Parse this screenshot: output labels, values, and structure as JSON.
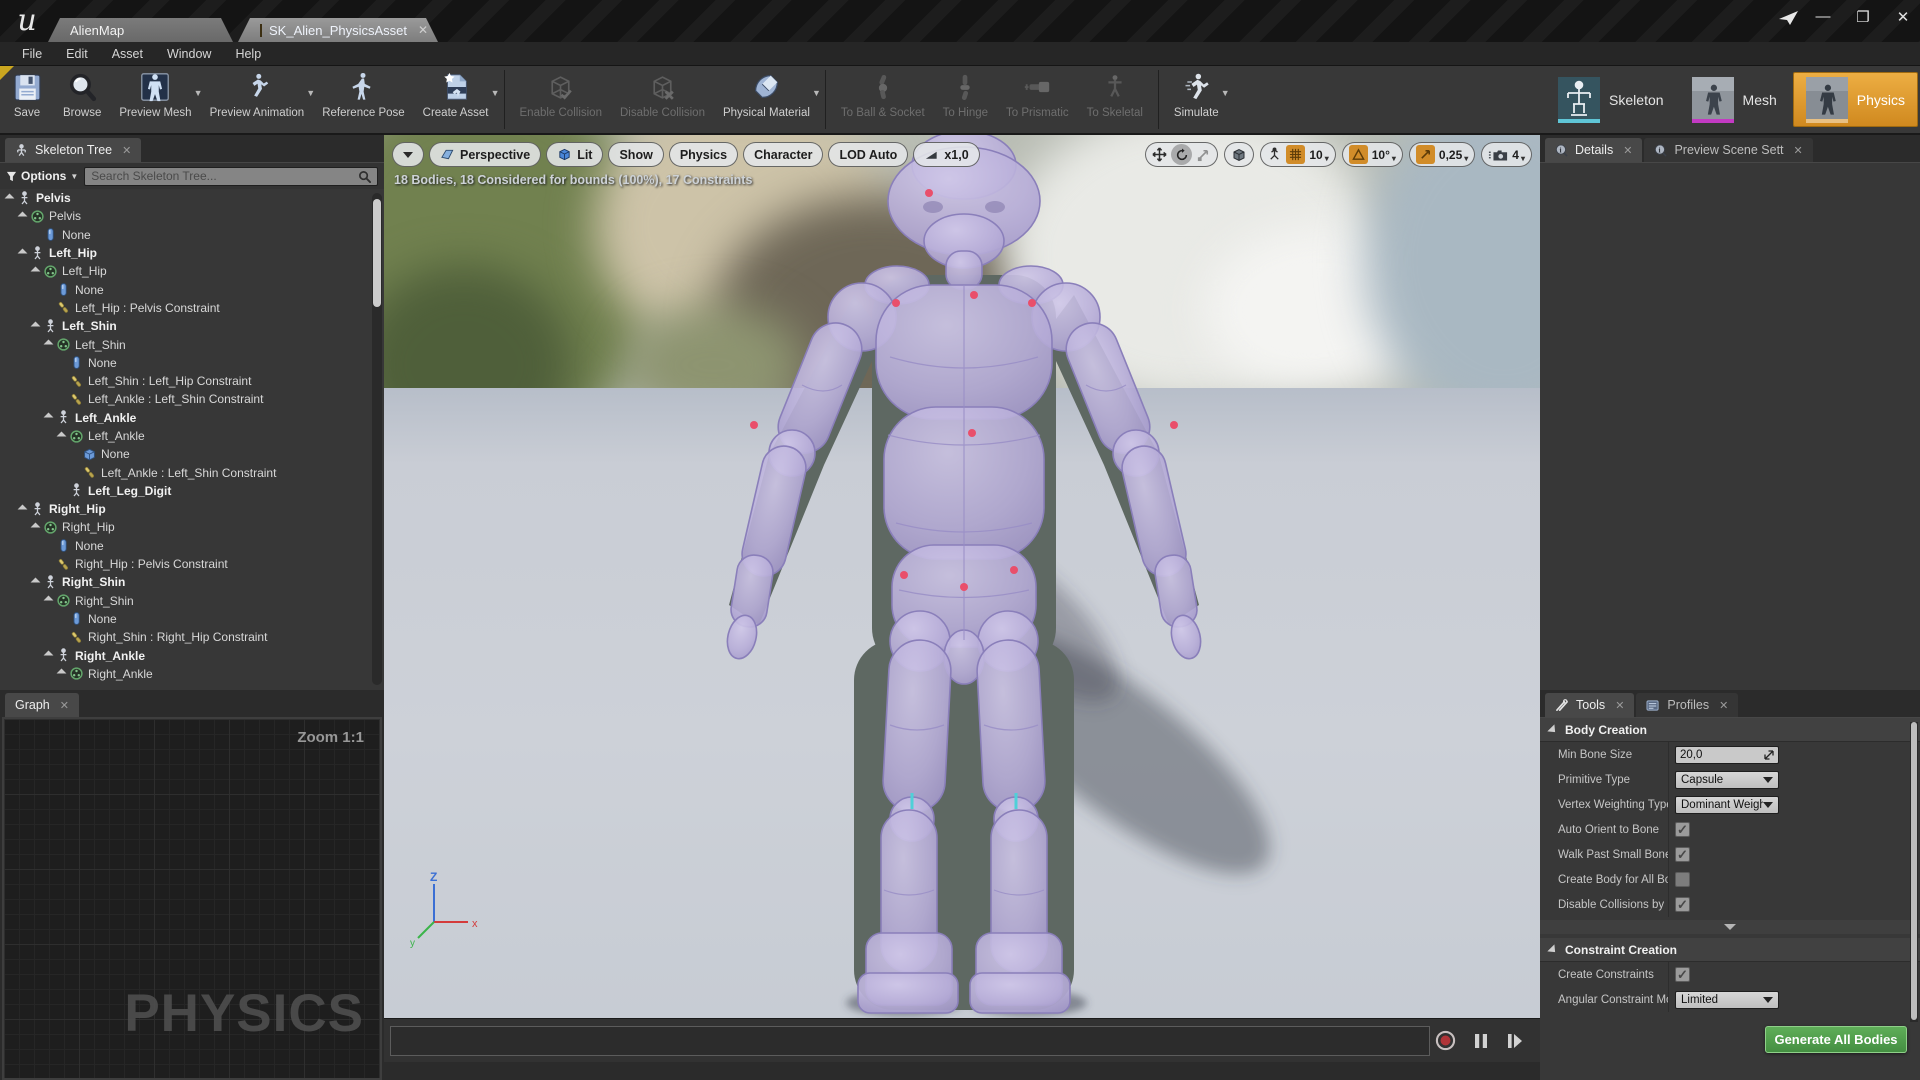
{
  "window": {
    "tabs": {
      "map": "AlienMap",
      "asset": "SK_Alien_PhysicsAsset"
    },
    "menu": [
      "File",
      "Edit",
      "Asset",
      "Window",
      "Help"
    ],
    "controls": {
      "minimize": "—",
      "maximize": "❐",
      "close": "✕"
    }
  },
  "toolbar": {
    "buttons": [
      {
        "label": "Save",
        "icon": "floppy"
      },
      {
        "label": "Browse",
        "icon": "magnifier"
      },
      {
        "label": "Preview Mesh",
        "icon": "previewmesh",
        "dropdown": true
      },
      {
        "label": "Preview Animation",
        "icon": "previewanim",
        "dropdown": true
      },
      {
        "label": "Reference Pose",
        "icon": "refpose"
      },
      {
        "label": "Create Asset",
        "icon": "createasset",
        "dropdown": true
      },
      {
        "sep": true
      },
      {
        "label": "Enable Collision",
        "icon": "cubecheck",
        "disabled": true
      },
      {
        "label": "Disable Collision",
        "icon": "cubex",
        "disabled": true
      },
      {
        "label": "Physical Material",
        "icon": "material",
        "dropdown": true
      },
      {
        "sep": true
      },
      {
        "label": "To Ball & Socket",
        "icon": "jointball",
        "disabled": true
      },
      {
        "label": "To Hinge",
        "icon": "jointhinge",
        "disabled": true
      },
      {
        "label": "To Prismatic",
        "icon": "jointprism",
        "disabled": true
      },
      {
        "label": "To Skeletal",
        "icon": "jointskel",
        "disabled": true
      },
      {
        "sep": true
      },
      {
        "label": "Simulate",
        "icon": "simulate",
        "dropdown": true
      }
    ],
    "modes": [
      {
        "label": "Skeleton",
        "icon": "modeskeleton",
        "active": false
      },
      {
        "label": "Mesh",
        "icon": "modemesh",
        "active": false
      },
      {
        "label": "Physics",
        "icon": "modephysics",
        "active": true
      }
    ]
  },
  "skeleton_tree": {
    "tab": "Skeleton Tree",
    "options_label": "Options",
    "search_placeholder": "Search Skeleton Tree...",
    "items": [
      {
        "label": "Pelvis",
        "type": "bone",
        "depth": 0,
        "exp": true
      },
      {
        "label": "Pelvis",
        "type": "body",
        "depth": 1,
        "exp": true
      },
      {
        "label": "None",
        "type": "capsule",
        "depth": 2
      },
      {
        "label": "Left_Hip",
        "type": "bone",
        "depth": 1,
        "exp": true
      },
      {
        "label": "Left_Hip",
        "type": "body",
        "depth": 2,
        "exp": true
      },
      {
        "label": "None",
        "type": "capsule",
        "depth": 3
      },
      {
        "label": "Left_Hip : Pelvis Constraint",
        "type": "constraint",
        "depth": 3
      },
      {
        "label": "Left_Shin",
        "type": "bone",
        "depth": 2,
        "exp": true
      },
      {
        "label": "Left_Shin",
        "type": "body",
        "depth": 3,
        "exp": true
      },
      {
        "label": "None",
        "type": "capsule",
        "depth": 4
      },
      {
        "label": "Left_Shin : Left_Hip Constraint",
        "type": "constraint",
        "depth": 4
      },
      {
        "label": "Left_Ankle : Left_Shin Constraint",
        "type": "constraint",
        "depth": 4
      },
      {
        "label": "Left_Ankle",
        "type": "bone",
        "depth": 3,
        "exp": true
      },
      {
        "label": "Left_Ankle",
        "type": "body",
        "depth": 4,
        "exp": true
      },
      {
        "label": "None",
        "type": "box",
        "depth": 5
      },
      {
        "label": "Left_Ankle : Left_Shin Constraint",
        "type": "constraint",
        "depth": 5
      },
      {
        "label": "Left_Leg_Digit",
        "type": "bone",
        "depth": 4
      },
      {
        "label": "Right_Hip",
        "type": "bone",
        "depth": 1,
        "exp": true
      },
      {
        "label": "Right_Hip",
        "type": "body",
        "depth": 2,
        "exp": true
      },
      {
        "label": "None",
        "type": "capsule",
        "depth": 3
      },
      {
        "label": "Right_Hip : Pelvis Constraint",
        "type": "constraint",
        "depth": 3
      },
      {
        "label": "Right_Shin",
        "type": "bone",
        "depth": 2,
        "exp": true
      },
      {
        "label": "Right_Shin",
        "type": "body",
        "depth": 3,
        "exp": true
      },
      {
        "label": "None",
        "type": "capsule",
        "depth": 4
      },
      {
        "label": "Right_Shin : Right_Hip Constraint",
        "type": "constraint",
        "depth": 4
      },
      {
        "label": "Right_Ankle",
        "type": "bone",
        "depth": 3,
        "exp": true
      },
      {
        "label": "Right_Ankle",
        "type": "body",
        "depth": 4,
        "exp": true
      }
    ]
  },
  "graph": {
    "tab": "Graph",
    "zoom_label": "Zoom 1:1",
    "watermark": "PHYSICS"
  },
  "viewport": {
    "stats": "18 Bodies, 18 Considered for bounds (100%), 17 Constraints",
    "toolbar": [
      {
        "label": "",
        "icon": "caret"
      },
      {
        "label": "Perspective",
        "icon": "persp"
      },
      {
        "label": "Lit",
        "icon": "lit"
      },
      {
        "label": "Show"
      },
      {
        "label": "Physics"
      },
      {
        "label": "Character"
      },
      {
        "label": "LOD Auto"
      },
      {
        "label": "x1,0",
        "icon": "speed"
      }
    ],
    "snaps": {
      "grid": "10",
      "angle": "10°",
      "scale": "0,25",
      "camera": "4"
    },
    "axis": {
      "x": "x",
      "y": "y",
      "z": "Z"
    }
  },
  "details_panel": {
    "tab_details": "Details",
    "tab_preview": "Preview Scene Sett"
  },
  "tools_panel": {
    "tab_tools": "Tools",
    "tab_profiles": "Profiles",
    "body_creation": {
      "title": "Body Creation",
      "rows": [
        {
          "label": "Min Bone Size",
          "type": "number",
          "value": "20,0"
        },
        {
          "label": "Primitive Type",
          "type": "select",
          "value": "Capsule"
        },
        {
          "label": "Vertex Weighting Type",
          "type": "select",
          "value": "Dominant Weight"
        },
        {
          "label": "Auto Orient to Bone",
          "type": "checkbox",
          "checked": true
        },
        {
          "label": "Walk Past Small Bone",
          "type": "checkbox",
          "checked": true
        },
        {
          "label": "Create Body for All Bo",
          "type": "checkbox",
          "checked": false
        },
        {
          "label": "Disable Collisions by D",
          "type": "checkbox",
          "checked": true
        }
      ]
    },
    "constraint_creation": {
      "title": "Constraint Creation",
      "rows": [
        {
          "label": "Create Constraints",
          "type": "checkbox",
          "checked": true
        },
        {
          "label": "Angular Constraint Mo",
          "type": "select",
          "value": "Limited"
        }
      ]
    },
    "generate_button": "Generate All Bodies"
  }
}
